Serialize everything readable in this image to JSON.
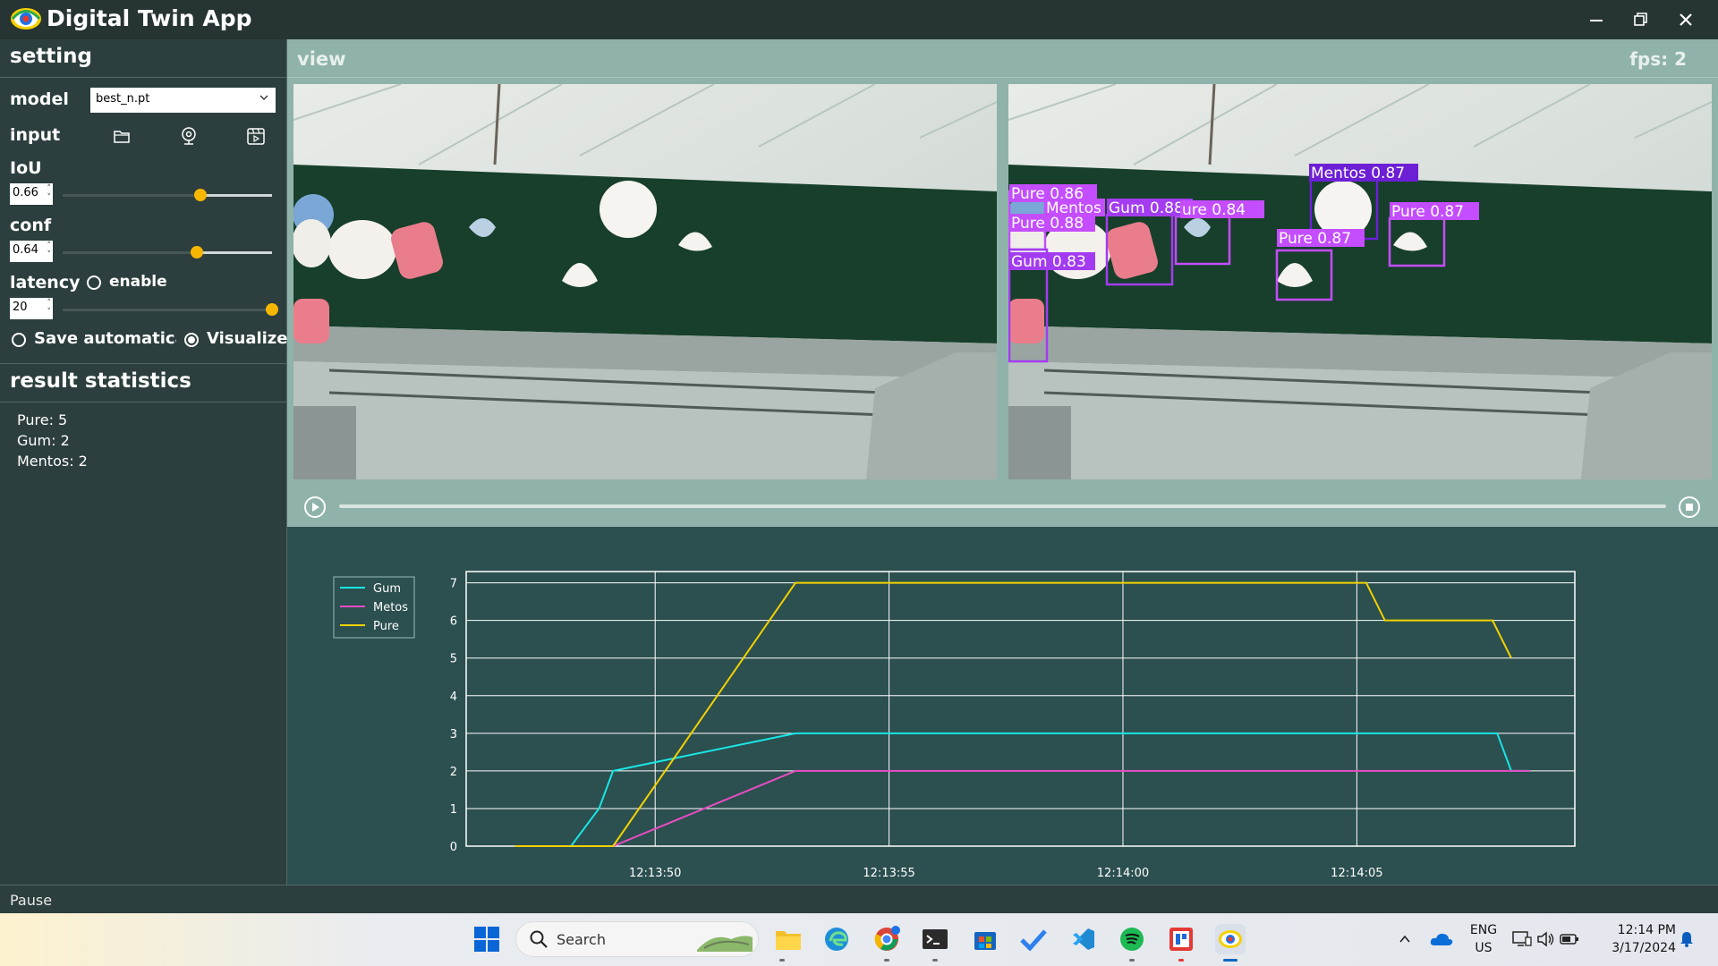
{
  "window": {
    "title": "Digital Twin App"
  },
  "setting": {
    "header": "setting",
    "model_label": "model",
    "model_value": "best_n.pt",
    "input_label": "input",
    "iou_label": "IoU",
    "iou_value": "0.66",
    "iou_level": 0.66,
    "conf_label": "conf",
    "conf_value": "0.64",
    "conf_level": 0.64,
    "latency_label": "latency",
    "latency_enable_label": "enable",
    "latency_value": "20",
    "latency_level": 1.0,
    "save_auto_label": "Save automatically",
    "visualize_label": "Visualize",
    "save_auto_checked": false,
    "visualize_checked": true
  },
  "stats": {
    "header": "result statistics",
    "items": [
      "Pure:  5",
      "Gum:  2",
      "Mentos:  2"
    ]
  },
  "view": {
    "title": "view",
    "fps": "fps: 2"
  },
  "detections": [
    {
      "label": "Pure 0.86",
      "color": "#c44dff"
    },
    {
      "label": "Mentos",
      "color": "#c44dff"
    },
    {
      "label": "Pure 0.88",
      "color": "#c44dff"
    },
    {
      "label": "Gum 0.83",
      "color": "#a33cf0"
    },
    {
      "label": "Gum 0.88",
      "color": "#a33cf0"
    },
    {
      "label": "ure 0.84",
      "color": "#c44dff"
    },
    {
      "label": "Mentos 0.87",
      "color": "#6d1fd6"
    },
    {
      "label": "Pure 0.87",
      "color": "#c44dff"
    },
    {
      "label": "Pure 0.87",
      "color": "#c44dff"
    }
  ],
  "status": {
    "text": "Pause"
  },
  "colors": {
    "accent": "#f5b700",
    "gum": "#19e6e6",
    "metos": "#e64dc2",
    "pure": "#f2d200"
  },
  "chart_data": {
    "type": "line",
    "x_ticks": [
      "12:13:50",
      "12:13:55",
      "12:14:00",
      "12:14:05"
    ],
    "x_tick_seconds": [
      50,
      55,
      60,
      65
    ],
    "xlim": [
      45.96,
      69.66
    ],
    "y_ticks": [
      "0",
      "1",
      "2",
      "3",
      "4",
      "5",
      "6",
      "7"
    ],
    "ylim": [
      0,
      7.3
    ],
    "grid": true,
    "legend_position": "top-left",
    "series": [
      {
        "name": "Gum",
        "color": "#19e6e6",
        "x": [
          47,
          48.2,
          48.8,
          49.1,
          53.0,
          68.0,
          68.3,
          68.7
        ],
        "y": [
          0,
          0,
          1,
          2,
          3,
          3,
          2,
          2
        ]
      },
      {
        "name": "Metos",
        "color": "#e64dc2",
        "x": [
          47,
          49.1,
          53.0,
          68.3,
          68.7
        ],
        "y": [
          0,
          0,
          2,
          2,
          2
        ]
      },
      {
        "name": "Pure",
        "color": "#f2d200",
        "x": [
          47,
          49.1,
          53.0,
          65.2,
          65.6,
          67.9,
          68.3
        ],
        "y": [
          0,
          0,
          7,
          7,
          6,
          6,
          5
        ]
      }
    ]
  },
  "taskbar": {
    "search_placeholder": "Search",
    "lang_top": "ENG",
    "lang_bottom": "US",
    "time": "12:14 PM",
    "date": "3/17/2024"
  }
}
